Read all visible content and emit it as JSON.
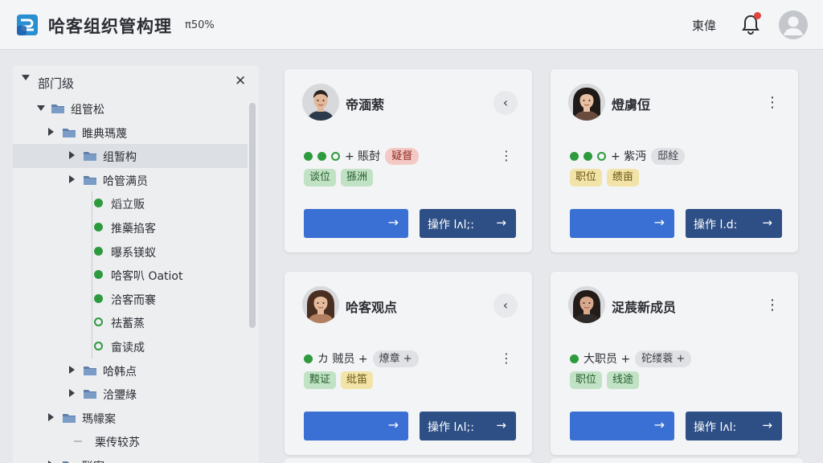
{
  "header": {
    "app_title": "哈客组织管构理",
    "zoom": "π50%",
    "right_link": "東偉",
    "icons": {
      "logo": "org-logo",
      "bell": "bell-icon",
      "user": "user-avatar-icon"
    }
  },
  "sidebar": {
    "title": "部门级",
    "close_label": "✕",
    "items": [
      {
        "label": "组管松",
        "kind": "folder",
        "indent": 0,
        "expanded": true
      },
      {
        "label": "睢典瑪蔑",
        "kind": "folder",
        "indent": 1,
        "expanded": false
      },
      {
        "label": "组暂构",
        "kind": "folder",
        "indent": 2,
        "expanded": false,
        "selected": true
      },
      {
        "label": "哈管满员",
        "kind": "folder",
        "indent": 2,
        "expanded": false
      },
      {
        "label": "熖立贩",
        "kind": "dot",
        "indent": 3
      },
      {
        "label": "推藥掐客",
        "kind": "dot",
        "indent": 3
      },
      {
        "label": "曝系镁蚁",
        "kind": "dot",
        "indent": 3
      },
      {
        "label": "哈客叭 Oatiot",
        "kind": "dot",
        "indent": 3
      },
      {
        "label": "洽客而褰",
        "kind": "dot",
        "indent": 3
      },
      {
        "label": "祛蓄蒸",
        "kind": "hollow",
        "indent": 3
      },
      {
        "label": "畲读成",
        "kind": "hollow",
        "indent": 3
      },
      {
        "label": "哈韩点",
        "kind": "folder",
        "indent": 2
      },
      {
        "label": "洽瓕綠",
        "kind": "folder",
        "indent": 2
      },
      {
        "label": "瑪幪案",
        "kind": "folder",
        "indent": 1
      },
      {
        "label": "栗传较苏",
        "kind": "line",
        "indent": 1
      },
      {
        "label": "联案 ᵃ",
        "kind": "folder",
        "indent": 1
      }
    ]
  },
  "cards": [
    {
      "name": "帝湎萦",
      "corner": "‹",
      "corner_kind": "back",
      "status_text": "+ 賬尌",
      "status_pill": "疑督",
      "status_pill_color": "red",
      "tags": [
        {
          "text": "谈位",
          "color": "green"
        },
        {
          "text": "猻洲",
          "color": "green"
        }
      ],
      "primary_arrow": "→",
      "action_label": "操作 lʌl;:",
      "action_arrow": "→",
      "more": "⋮",
      "dots": [
        "solid",
        "solid",
        "ring"
      ]
    },
    {
      "name": "燈虜侸",
      "corner": "⋮",
      "corner_kind": "more",
      "status_text": "+ 紫沔",
      "status_pill": "邸絟",
      "status_pill_color": "grey",
      "tags": [
        {
          "text": "职位",
          "color": "yellow"
        },
        {
          "text": "缋亩",
          "color": "yellow"
        }
      ],
      "primary_arrow": "→",
      "action_label": "操作 l.d:",
      "action_arrow": "→",
      "more": "",
      "dots": [
        "solid",
        "solid",
        "ring"
      ]
    },
    {
      "name": "哈客观点",
      "corner": "‹",
      "corner_kind": "back",
      "status_text": "カ 贼员 +",
      "status_pill": "燎章 +",
      "status_pill_color": "grey",
      "tags": [
        {
          "text": "黢证",
          "color": "green"
        },
        {
          "text": "纰笛",
          "color": "yellow"
        }
      ],
      "primary_arrow": "→",
      "action_label": "操作 lʌl;:",
      "action_arrow": "→",
      "more": "⋮",
      "dots": [
        "solid"
      ]
    },
    {
      "name": "浞莀新成员",
      "corner": "⋮",
      "corner_kind": "more",
      "status_text": "大职员 +",
      "status_pill": "砣缕蓑 +",
      "status_pill_color": "grey",
      "tags": [
        {
          "text": "职位",
          "color": "green"
        },
        {
          "text": "线途",
          "color": "green"
        }
      ],
      "primary_arrow": "→",
      "action_label": "操作 lʌl:",
      "action_arrow": "→",
      "more": "",
      "dots": [
        "solid"
      ]
    }
  ]
}
